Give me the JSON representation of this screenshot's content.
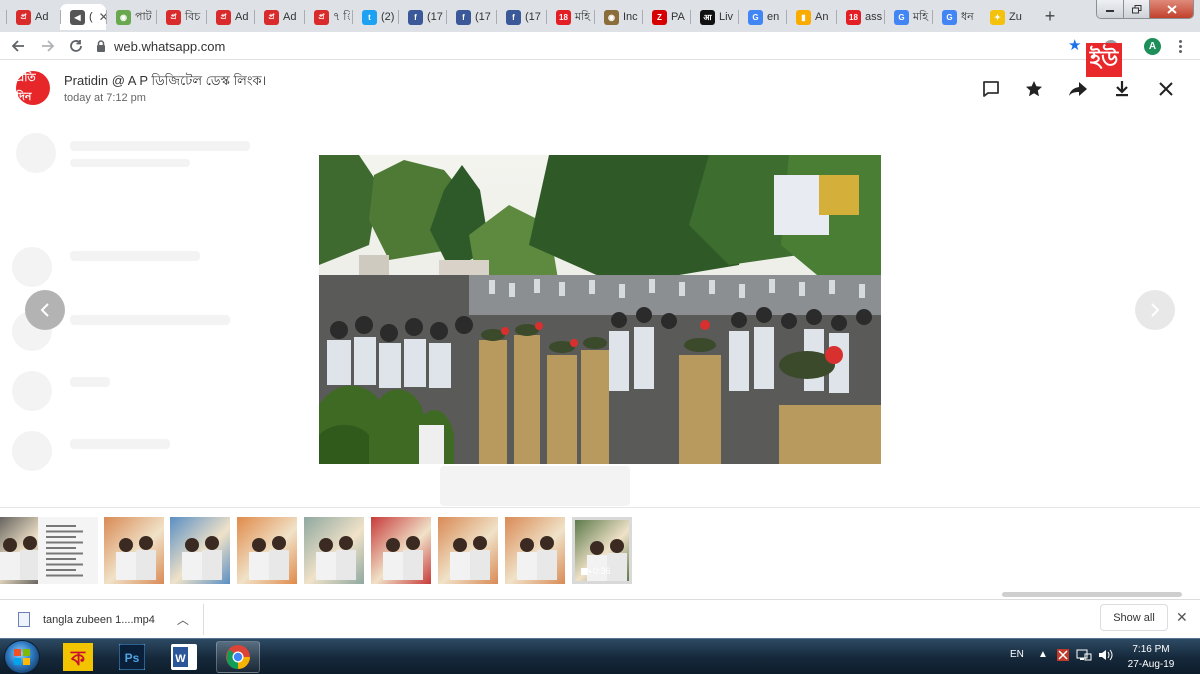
{
  "browser": {
    "tabs": [
      {
        "label": "Ad",
        "favicon": "pratidin-logo-icon",
        "color": "#d92b2b"
      },
      {
        "label": "(",
        "favicon": "speaker-icon",
        "color": "#555555",
        "active": true,
        "close": "✕"
      },
      {
        "label": "পাট",
        "favicon": "emblem-icon",
        "color": "#6aa84f"
      },
      {
        "label": "বিচ",
        "favicon": "pratidin-logo-icon",
        "color": "#d92b2b"
      },
      {
        "label": "Ad",
        "favicon": "pratidin-logo-icon",
        "color": "#d92b2b"
      },
      {
        "label": "Ad",
        "favicon": "pratidin-logo-icon",
        "color": "#d92b2b"
      },
      {
        "label": "৭ ি",
        "favicon": "pratidin-logo-icon",
        "color": "#d92b2b"
      },
      {
        "label": "(2)",
        "favicon": "twitter-icon",
        "color": "#1da1f2"
      },
      {
        "label": "(17",
        "favicon": "facebook-icon",
        "color": "#3b5998"
      },
      {
        "label": "(17",
        "favicon": "facebook-icon",
        "color": "#3b5998"
      },
      {
        "label": "(17",
        "favicon": "facebook-icon",
        "color": "#3b5998"
      },
      {
        "label": "মহি",
        "favicon": "eighteen-logo-icon",
        "color": "#e31e24"
      },
      {
        "label": "Inc",
        "favicon": "emblem-icon",
        "color": "#8a6d3b"
      },
      {
        "label": "PA",
        "favicon": "zee-logo-icon",
        "color": "#d60000"
      },
      {
        "label": "Liv",
        "favicon": "aaj-tak-logo-icon",
        "color": "#111111"
      },
      {
        "label": "en",
        "favicon": "google-icon",
        "color": "#4285f4"
      },
      {
        "label": "An",
        "favicon": "analytics-icon",
        "color": "#f9ab00"
      },
      {
        "label": "ass",
        "favicon": "eighteen-logo-icon",
        "color": "#e31e24"
      },
      {
        "label": "মহি",
        "favicon": "google-icon",
        "color": "#4285f4"
      },
      {
        "label": "ধন",
        "favicon": "google-icon",
        "color": "#4285f4"
      },
      {
        "label": "Zu",
        "favicon": "lightbulb-icon",
        "color": "#f4c20d"
      }
    ],
    "new_tab": "+",
    "address": "web.whatsapp.com",
    "profile_initial": "A",
    "brand_badge": "ইউ"
  },
  "viewer": {
    "sender": "Pratidin @ A P ডিজিটেল ডেস্ক লিংক।",
    "time": "today at 7:12 pm",
    "avatar_text": "প্রতি দিন",
    "actions": [
      "message-icon",
      "star-icon",
      "forward-icon",
      "download-icon",
      "close-icon"
    ],
    "thumbnails": [
      {
        "kind": "photo",
        "palette": "#4a4a4a"
      },
      {
        "kind": "document",
        "palette": "#f4f4f4"
      },
      {
        "kind": "photo",
        "palette": "#d98a55"
      },
      {
        "kind": "photo",
        "palette": "#5a8fc4"
      },
      {
        "kind": "photo",
        "palette": "#e08a4a"
      },
      {
        "kind": "photo",
        "palette": "#8fa8a0"
      },
      {
        "kind": "photo",
        "palette": "#c73a3a"
      },
      {
        "kind": "photo",
        "palette": "#d98a55"
      },
      {
        "kind": "photo",
        "palette": "#d98a55"
      },
      {
        "kind": "video",
        "palette": "#5c7a4a",
        "duration": "0:36",
        "selected": true
      }
    ]
  },
  "downloads": {
    "item": "tangla zubeen 1....mp4",
    "show_all": "Show all"
  },
  "taskbar": {
    "apps": [
      "bangla-keyboard-app",
      "photoshop-app",
      "word-app",
      "chrome-app"
    ],
    "language": "EN",
    "time": "7:16 PM",
    "date": "27-Aug-19"
  }
}
